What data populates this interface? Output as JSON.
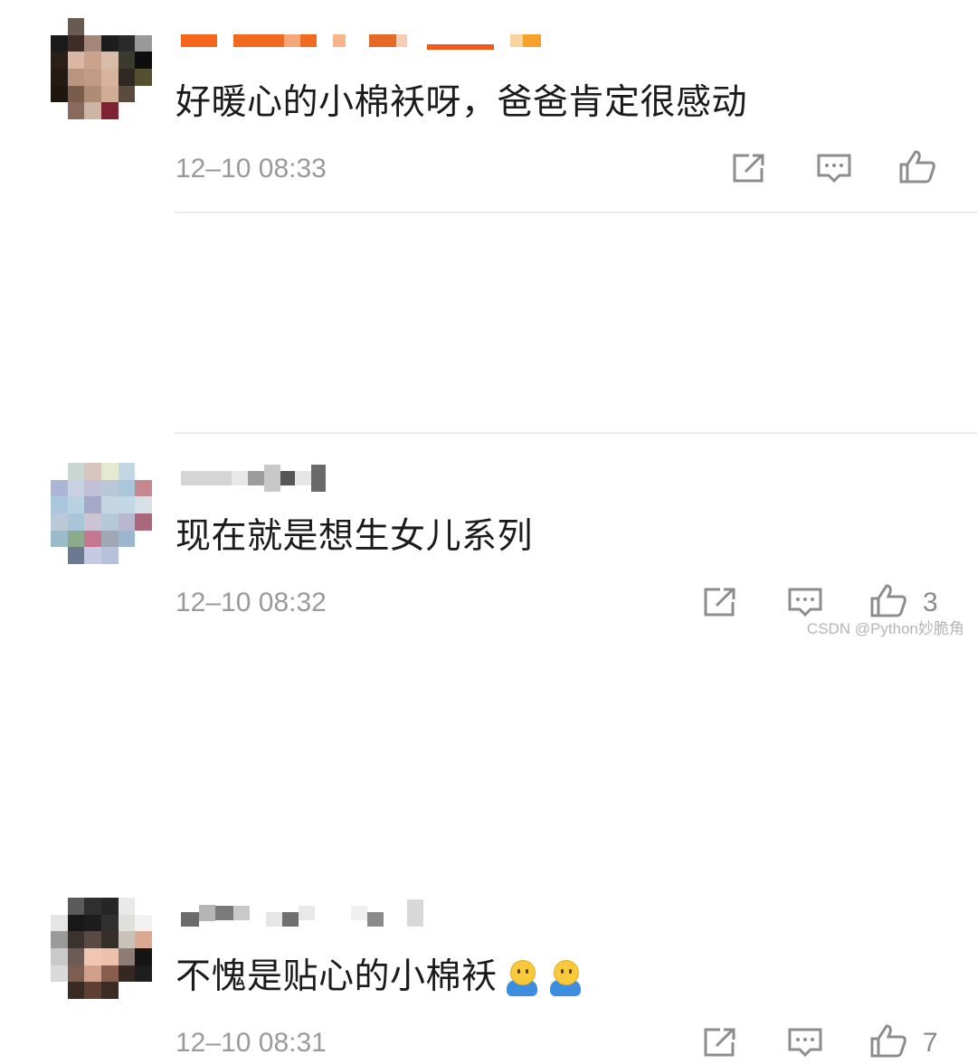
{
  "comments": [
    {
      "text": "好暖心的小棉袄呀，爸爸肯定很感动",
      "time": "12–10 08:33",
      "likes": ""
    },
    {
      "text": "现在就是想生女儿系列",
      "time": "12–10 08:32",
      "likes": "3"
    },
    {
      "text": "不愧是贴心的小棉袄",
      "time": "12–10 08:31",
      "likes": "7"
    }
  ],
  "icons": [
    "share-icon",
    "comment-icon",
    "like-icon",
    "hugging-face-emoji"
  ],
  "watermark": "CSDN @Python妙脆角"
}
